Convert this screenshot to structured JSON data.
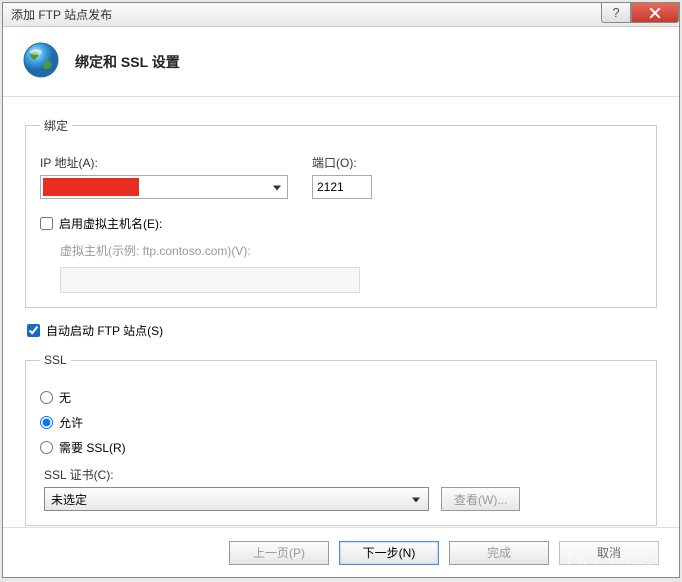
{
  "window": {
    "title": "添加 FTP 站点发布",
    "help_symbol": "?",
    "close_label": "Close"
  },
  "header": {
    "title": "绑定和 SSL 设置"
  },
  "binding": {
    "legend": "绑定",
    "ip_label": "IP 地址(A):",
    "ip_value": "",
    "port_label": "端口(O):",
    "port_value": "2121",
    "enable_vhost_label": "启用虚拟主机名(E):",
    "enable_vhost_checked": false,
    "vhost_label": "虚拟主机(示例: ftp.contoso.com)(V):",
    "vhost_value": ""
  },
  "autostart": {
    "label": "自动启动 FTP 站点(S)",
    "checked": true
  },
  "ssl": {
    "legend": "SSL",
    "options": {
      "none": "无",
      "allow": "允许",
      "require": "需要 SSL(R)"
    },
    "selected": "allow",
    "cert_label": "SSL 证书(C):",
    "cert_value": "未选定",
    "view_button": "查看(W)..."
  },
  "footer": {
    "prev": "上一页(P)",
    "next": "下一步(N)",
    "finish": "完成",
    "cancel": "取消"
  },
  "watermark": "系统之家"
}
